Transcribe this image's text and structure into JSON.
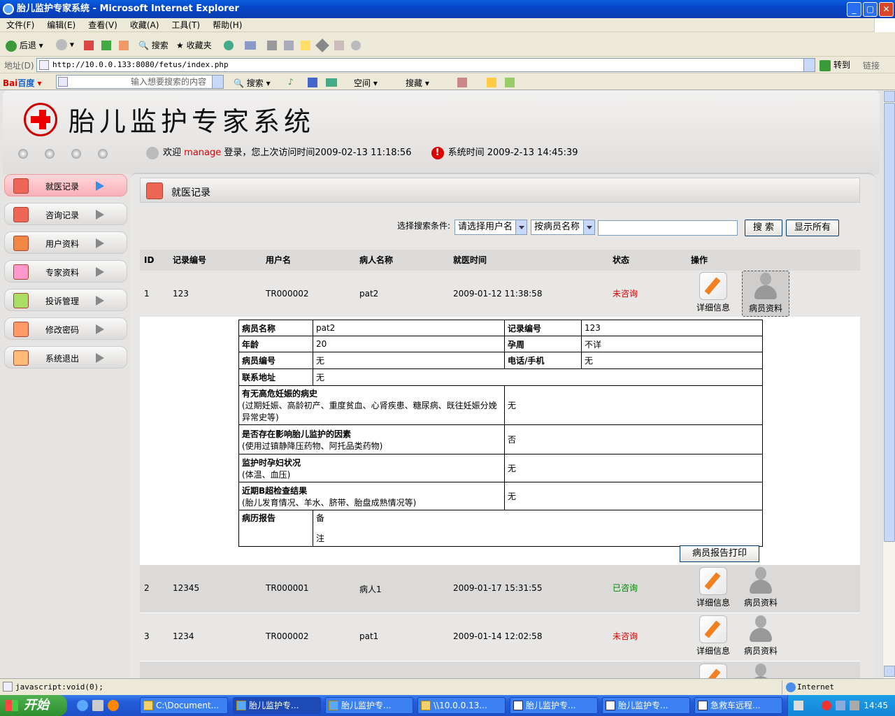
{
  "window": {
    "title": "胎儿监护专家系统 - Microsoft Internet Explorer"
  },
  "menu": [
    "文件(F)",
    "编辑(E)",
    "查看(V)",
    "收藏(A)",
    "工具(T)",
    "帮助(H)"
  ],
  "toolbar": {
    "back": "后退",
    "search": "搜索",
    "favorites": "收藏夹"
  },
  "address": {
    "label": "地址(D)",
    "url": "http://10.0.0.133:8080/fetus/index.php",
    "go": "转到",
    "links": "链接"
  },
  "baidu": {
    "logo_bai": "Bai",
    "logo_du": "百度",
    "placeholder": "输入想要搜索的内容",
    "search": "搜索",
    "space": "空间",
    "tieba": "搜藏"
  },
  "app": {
    "title": "胎儿监护专家系统"
  },
  "welcome": {
    "prefix": "欢迎",
    "user": "manage",
    "text": "登录，您上次访问时间2009-02-13 11:18:56",
    "sys_label": "系统时间",
    "sys_time": "2009-2-13 14:45:39"
  },
  "sidebar": [
    {
      "label": "就医记录",
      "active": true,
      "icon": "monitor-icon"
    },
    {
      "label": "咨询记录",
      "active": false,
      "icon": "cross-icon"
    },
    {
      "label": "用户资料",
      "active": false,
      "icon": "user-icon"
    },
    {
      "label": "专家资料",
      "active": false,
      "icon": "doctor-icon"
    },
    {
      "label": "投诉管理",
      "active": false,
      "icon": "complaint-icon"
    },
    {
      "label": "修改密码",
      "active": false,
      "icon": "key-icon"
    },
    {
      "label": "系统退出",
      "active": false,
      "icon": "exit-icon"
    }
  ],
  "section": {
    "title": "就医记录"
  },
  "search": {
    "label": "选择搜索条件:",
    "select1": "请选择用户名",
    "select2": "按病员名称",
    "value": "",
    "search_btn": "搜 索",
    "showall_btn": "显示所有"
  },
  "table": {
    "headers": [
      "ID",
      "记录编号",
      "用户名",
      "病人名称",
      "就医时间",
      "状态",
      "操作"
    ],
    "rows": [
      {
        "id": "1",
        "record": "123",
        "user": "TR000002",
        "patient": "pat2",
        "time": "2009-01-12 11:38:58",
        "status": "未咨询"
      },
      {
        "id": "2",
        "record": "12345",
        "user": "TR000001",
        "patient": "病人1",
        "time": "2009-01-17 15:31:55",
        "status": "已咨询"
      },
      {
        "id": "3",
        "record": "1234",
        "user": "TR000002",
        "patient": "pat1",
        "time": "2009-01-14 12:02:58",
        "status": "未咨询"
      }
    ],
    "action_detail": "详细信息",
    "action_profile": "病员资料"
  },
  "detail": {
    "name_k": "病员名称",
    "name_v": "pat2",
    "rec_k": "记录编号",
    "rec_v": "123",
    "age_k": "年龄",
    "age_v": "20",
    "week_k": "孕周",
    "week_v": "不详",
    "no_k": "病员编号",
    "no_v": "无",
    "tel_k": "电话/手机",
    "tel_v": "无",
    "addr_k": "联系地址",
    "addr_v": "无",
    "q1_k": "有无高危妊娠的病史",
    "q1_sub": "(过期妊娠、高龄初产、重度贫血、心肾疾患、糖尿病、既往妊娠分娩异常史等)",
    "q1_v": "无",
    "q2_k": "是否存在影响胎儿监护的因素",
    "q2_sub": "(使用过镇静降压药物、阿托品类药物)",
    "q2_v": "否",
    "q3_k": "监护时孕妇状况",
    "q3_sub": "(体温、血压)",
    "q3_v": "无",
    "q4_k": "近期B超检查结果",
    "q4_sub": "(胎儿发育情况、羊水、脐带、胎盘成熟情况等)",
    "q4_v": "无",
    "rep_k": "病历报告",
    "rep_v1": "备",
    "rep_v2": "注",
    "print_btn": "病员报告打印"
  },
  "statusbar": {
    "text": "javascript:void(0);",
    "zone": "Internet"
  },
  "taskbar": {
    "start": "开始",
    "items": [
      "C:\\Document...",
      "胎儿监护专...",
      "胎儿监护专...",
      "\\\\10.0.0.13...",
      "胎儿监护专...",
      "胎儿监护专...",
      "急救车远程..."
    ],
    "clock": "14:45"
  }
}
